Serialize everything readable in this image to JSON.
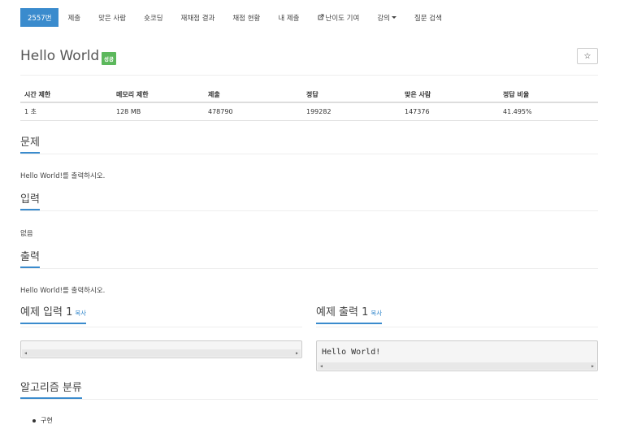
{
  "nav": {
    "items": [
      {
        "label": "2557번"
      },
      {
        "label": "제출"
      },
      {
        "label": "맞은 사람"
      },
      {
        "label": "숏코딩"
      },
      {
        "label": "재채점 결과"
      },
      {
        "label": "채점 현황"
      },
      {
        "label": "내 제출"
      },
      {
        "label": "난이도 기여",
        "icon": "external-link-icon"
      },
      {
        "label": "강의",
        "icon": "caret-down-icon"
      },
      {
        "label": "질문 검색"
      }
    ]
  },
  "problem": {
    "title": "Hello World",
    "badge": "성공",
    "star": "☆"
  },
  "stats": {
    "headers": [
      "시간 제한",
      "메모리 제한",
      "제출",
      "정답",
      "맞은 사람",
      "정답 비율"
    ],
    "values": [
      "1 초",
      "128 MB",
      "478790",
      "199282",
      "147376",
      "41.495%"
    ]
  },
  "sections": {
    "problem_heading": "문제",
    "problem_text": "Hello World!를 출력하시오.",
    "input_heading": "입력",
    "input_text": "없음",
    "output_heading": "출력",
    "output_text": "Hello World!를 출력하시오."
  },
  "samples": {
    "input_heading": "예제 입력 1",
    "input_copy": "복사",
    "input_value": "",
    "output_heading": "예제 출력 1",
    "output_copy": "복사",
    "output_value": "Hello World!"
  },
  "algorithm": {
    "heading": "알고리즘 분류",
    "tags": [
      "구현"
    ]
  },
  "colors": {
    "accent": "#3a8bcd",
    "success": "#5cb85c"
  }
}
